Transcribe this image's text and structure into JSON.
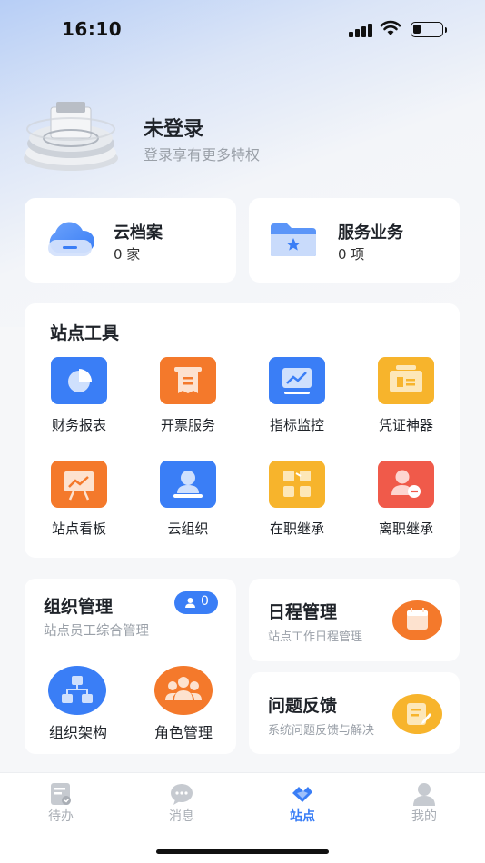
{
  "status_bar": {
    "time": "16:10"
  },
  "user": {
    "name": "未登录",
    "subtitle": "登录享有更多特权"
  },
  "stats": [
    {
      "title": "云档案",
      "value": "0 家",
      "icon": "cloud-icon"
    },
    {
      "title": "服务业务",
      "value": "0 项",
      "icon": "folder-star-icon"
    }
  ],
  "site_tools": {
    "title": "站点工具",
    "items": [
      {
        "label": "财务报表",
        "icon": "pie-chart-icon",
        "color": "#3a7ef6"
      },
      {
        "label": "开票服务",
        "icon": "receipt-icon",
        "color": "#f4792b"
      },
      {
        "label": "指标监控",
        "icon": "monitor-chart-icon",
        "color": "#3a7ef6"
      },
      {
        "label": "凭证神器",
        "icon": "ticket-icon",
        "color": "#f7b42c"
      },
      {
        "label": "站点看板",
        "icon": "board-icon",
        "color": "#f4792b"
      },
      {
        "label": "云组织",
        "icon": "org-person-icon",
        "color": "#3a7ef6"
      },
      {
        "label": "在职继承",
        "icon": "swap-icon",
        "color": "#f7b42c"
      },
      {
        "label": "离职继承",
        "icon": "person-leave-icon",
        "color": "#f05a4a"
      }
    ]
  },
  "org_management": {
    "title": "组织管理",
    "subtitle": "站点员工综合管理",
    "badge_count": "0",
    "items": [
      {
        "label": "组织架构",
        "icon": "hierarchy-icon",
        "color": "#3a7ef6"
      },
      {
        "label": "角色管理",
        "icon": "group-icon",
        "color": "#f4792b"
      }
    ]
  },
  "schedule": {
    "title": "日程管理",
    "subtitle": "站点工作日程管理",
    "icon": "calendar-icon",
    "color": "#f4792b"
  },
  "feedback": {
    "title": "问题反馈",
    "subtitle": "系统问题反馈与解决",
    "icon": "note-edit-icon",
    "color": "#f7b42c"
  },
  "tabbar": {
    "active": "站点",
    "items": [
      {
        "label": "待办",
        "icon": "todo-icon"
      },
      {
        "label": "消息",
        "icon": "message-icon"
      },
      {
        "label": "站点",
        "icon": "site-icon"
      },
      {
        "label": "我的",
        "icon": "profile-icon"
      }
    ]
  }
}
